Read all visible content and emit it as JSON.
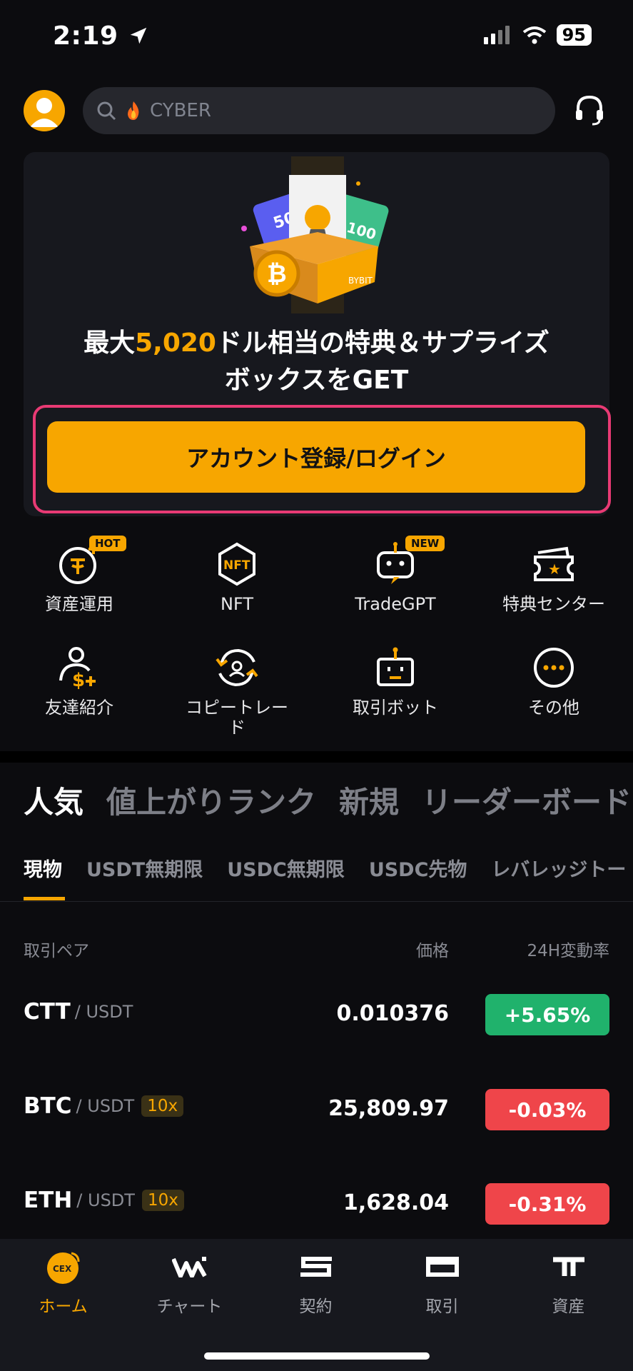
{
  "status": {
    "time": "2:19",
    "battery": "95"
  },
  "header": {
    "search_placeholder": "CYBER"
  },
  "banner": {
    "line1_pre": "最大",
    "line1_amount": "5,020",
    "line1_post": "ドル相当の特典＆サプライズ",
    "line2": "ボックスをGET",
    "cta": "アカウント登録/ログイン",
    "ticket_50": "50",
    "ticket_100": "100",
    "box_text": "BYBIT"
  },
  "quick": [
    {
      "label": "資産運用",
      "badge": "HOT",
      "icon": "tether-icon"
    },
    {
      "label": "NFT",
      "badge": "",
      "icon": "nft-icon"
    },
    {
      "label": "TradeGPT",
      "badge": "NEW",
      "icon": "tradegpt-icon"
    },
    {
      "label": "特典センター",
      "badge": "",
      "icon": "ticket-icon"
    },
    {
      "label": "友達紹介",
      "badge": "",
      "icon": "referral-icon"
    },
    {
      "label": "コピートレード",
      "badge": "",
      "icon": "copytrade-icon"
    },
    {
      "label": "取引ボット",
      "badge": "",
      "icon": "bot-icon"
    },
    {
      "label": "その他",
      "badge": "",
      "icon": "more-icon"
    }
  ],
  "top_tabs": [
    "人気",
    "値上がりランク",
    "新規",
    "リーダーボード"
  ],
  "sub_tabs": [
    "現物",
    "USDT無期限",
    "USDC無期限",
    "USDC先物",
    "レバレッジトー"
  ],
  "table": {
    "headers": {
      "pair": "取引ペア",
      "price": "価格",
      "change": "24H変動率"
    },
    "rows": [
      {
        "base": "CTT",
        "quote": "/ USDT",
        "lev": "",
        "price": "0.010376",
        "change": "+5.65%",
        "dir": "up"
      },
      {
        "base": "BTC",
        "quote": "/ USDT",
        "lev": "10x",
        "price": "25,809.97",
        "change": "-0.03%",
        "dir": "down"
      },
      {
        "base": "ETH",
        "quote": "/ USDT",
        "lev": "10x",
        "price": "1,628.04",
        "change": "-0.31%",
        "dir": "down"
      }
    ]
  },
  "nav": [
    {
      "label": "ホーム",
      "active": true,
      "icon": "cex-icon",
      "icon_text": "CEX"
    },
    {
      "label": "チャート",
      "active": false,
      "icon": "chart-icon"
    },
    {
      "label": "契約",
      "active": false,
      "icon": "contract-icon"
    },
    {
      "label": "取引",
      "active": false,
      "icon": "trade-icon"
    },
    {
      "label": "資産",
      "active": false,
      "icon": "assets-icon"
    }
  ],
  "colors": {
    "accent": "#f7a600",
    "up": "#20b26c",
    "down": "#ef454a",
    "highlight": "#e83a74"
  }
}
